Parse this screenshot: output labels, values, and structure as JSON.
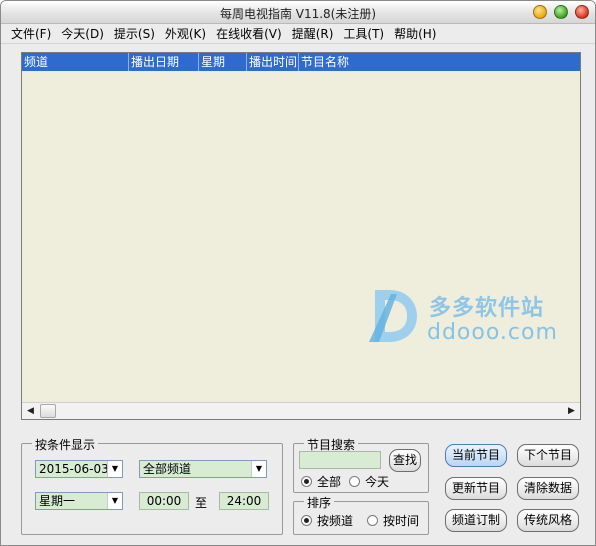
{
  "window": {
    "title": "每周电视指南 V11.8(未注册)"
  },
  "menu": [
    "文件(F)",
    "今天(D)",
    "提示(S)",
    "外观(K)",
    "在线收看(V)",
    "提醒(R)",
    "工具(T)",
    "帮助(H)"
  ],
  "table": {
    "columns": [
      "频道",
      "播出日期",
      "星期",
      "播出时间",
      "节目名称"
    ],
    "rows": []
  },
  "watermark": {
    "cn": "多多软件站",
    "en": "ddooo.com"
  },
  "filter": {
    "title": "按条件显示",
    "date": "2015-06-03",
    "channel": "全部频道",
    "weekday": "星期一",
    "time_from": "00:00",
    "to_label": "至",
    "time_to": "24:00"
  },
  "search": {
    "title": "节目搜索",
    "query": "",
    "find_label": "查找",
    "opt_all": "全部",
    "opt_today": "今天",
    "selected": "all"
  },
  "sort": {
    "title": "排序",
    "opt_channel": "按频道",
    "opt_time": "按时间",
    "selected": "channel"
  },
  "buttons": {
    "current": "当前节目",
    "next": "下个节目",
    "update": "更新节目",
    "clear": "清除数据",
    "channels": "频道订制",
    "classic": "传统风格"
  },
  "colors": {
    "header": "#2d6bd0",
    "list_bg": "#efeedd",
    "field_bg": "#d8ecd3",
    "watermark": "#8fc5e6"
  }
}
